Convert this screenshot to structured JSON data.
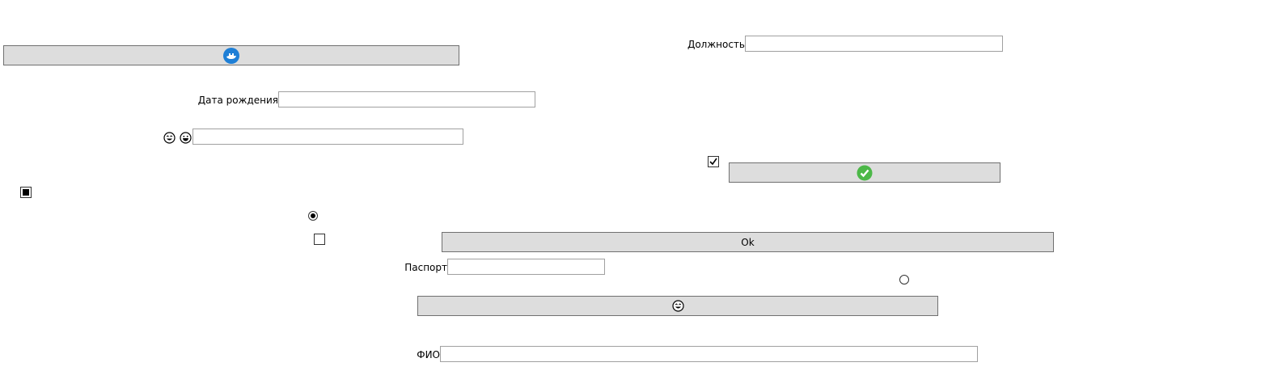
{
  "labels": {
    "position": "Должность",
    "birth_date": "Дата рождения",
    "passport": "Паспорт",
    "full_name": "ФИО"
  },
  "fields": {
    "position": "",
    "birth_date": "",
    "emoji_field": "",
    "passport": "",
    "full_name": ""
  },
  "buttons": {
    "ok_label": "Ok"
  },
  "icons": {
    "top_button_icon": "whale-icon",
    "check_button_icon": "green-check-circle-icon",
    "emoji_button_icon": "smiley-face-icon",
    "field_label_icons": [
      "laughing-face-icon",
      "grinning-face-icon"
    ]
  },
  "controls": {
    "checkbox_indeterminate": "indeterminate",
    "checkbox_checked": true,
    "checkbox_unchecked": false,
    "radio_selected": true,
    "radio_unselected": false
  },
  "colors": {
    "button_bg": "#dddddd",
    "accent_blue": "#1e7fd6",
    "accent_green": "#4cb848"
  }
}
